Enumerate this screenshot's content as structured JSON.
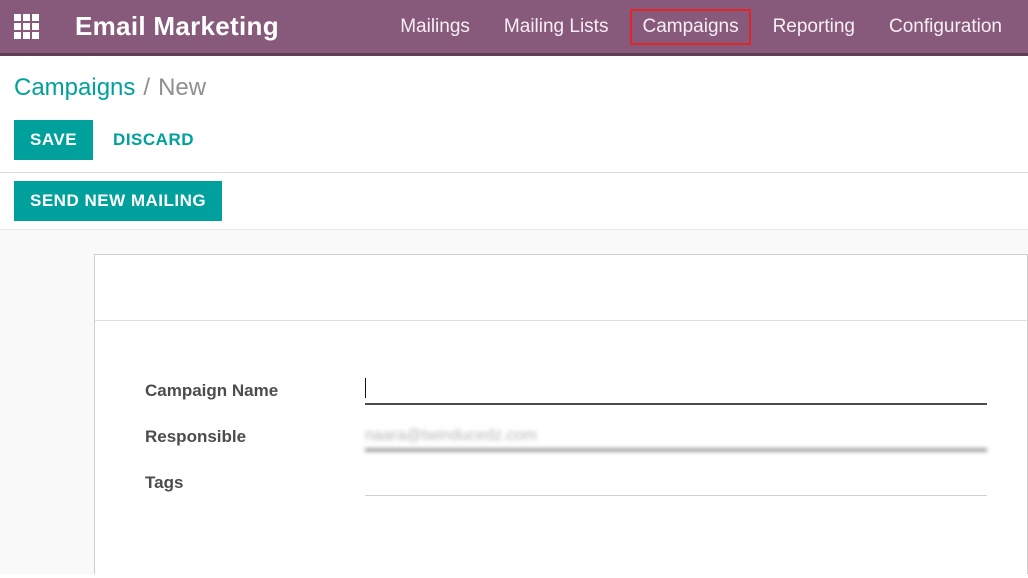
{
  "header": {
    "app_title": "Email Marketing",
    "nav": [
      {
        "label": "Mailings",
        "highlight": false
      },
      {
        "label": "Mailing Lists",
        "highlight": false
      },
      {
        "label": "Campaigns",
        "highlight": true
      },
      {
        "label": "Reporting",
        "highlight": false
      },
      {
        "label": "Configuration",
        "highlight": false
      }
    ]
  },
  "breadcrumb": {
    "parent": "Campaigns",
    "sep": "/",
    "current": "New"
  },
  "actions": {
    "save": "SAVE",
    "discard": "DISCARD",
    "send_new_mailing": "SEND NEW MAILING"
  },
  "form": {
    "fields": {
      "campaign_name": {
        "label": "Campaign Name",
        "value": ""
      },
      "responsible": {
        "label": "Responsible",
        "value": "naara@twinducedz.com"
      },
      "tags": {
        "label": "Tags",
        "value": ""
      }
    }
  }
}
